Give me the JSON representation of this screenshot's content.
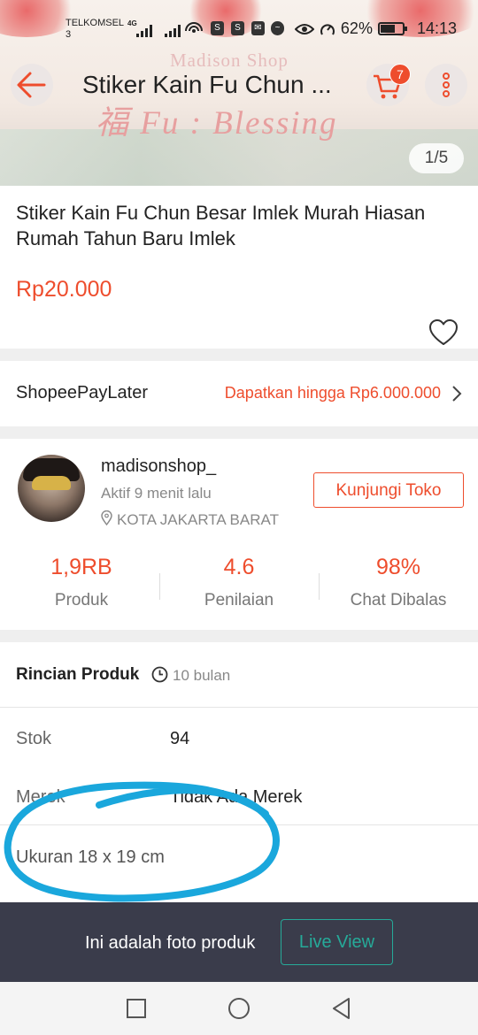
{
  "status_bar": {
    "carrier": "TELKOMSEL",
    "carrier_sub": "3",
    "network": "4G",
    "battery": "62%",
    "time": "14:13"
  },
  "hero": {
    "watermark": "Madison Shop",
    "blessing_text": "福 Fu : Blessing",
    "image_counter": "1/5"
  },
  "app_bar": {
    "title": "Stiker Kain Fu Chun ...",
    "cart_count": "7",
    "back_icon": "arrow-left-icon",
    "cart_icon": "cart-icon",
    "more_icon": "more-vertical-icon"
  },
  "product": {
    "title": "Stiker Kain Fu Chun Besar Imlek Murah Hiasan Rumah Tahun Baru Imlek",
    "price": "Rp20.000"
  },
  "paylater": {
    "label": "ShopeePayLater",
    "value": "Dapatkan hingga Rp6.000.000"
  },
  "shop": {
    "name": "madisonshop_",
    "active": "Aktif 9 menit lalu",
    "location": "KOTA JAKARTA BARAT",
    "visit_label": "Kunjungi Toko",
    "stats": [
      {
        "value": "1,9RB",
        "label": "Produk"
      },
      {
        "value": "4.6",
        "label": "Penilaian"
      },
      {
        "value": "98%",
        "label": "Chat Dibalas"
      }
    ]
  },
  "details": {
    "title": "Rincian Produk",
    "age": "10 bulan",
    "rows": [
      {
        "label": "Stok",
        "value": "94"
      },
      {
        "label": "Merek",
        "value": "Tidak Ada Merek"
      }
    ],
    "description": "Ukuran 18 x 19 cm"
  },
  "banner": {
    "text": "Ini adalah foto produk",
    "button": "Live View"
  },
  "colors": {
    "accent": "#ee4d2d",
    "teal": "#26aa99",
    "banner_bg": "#3a3c4b",
    "annotation": "#1aa7dc"
  }
}
